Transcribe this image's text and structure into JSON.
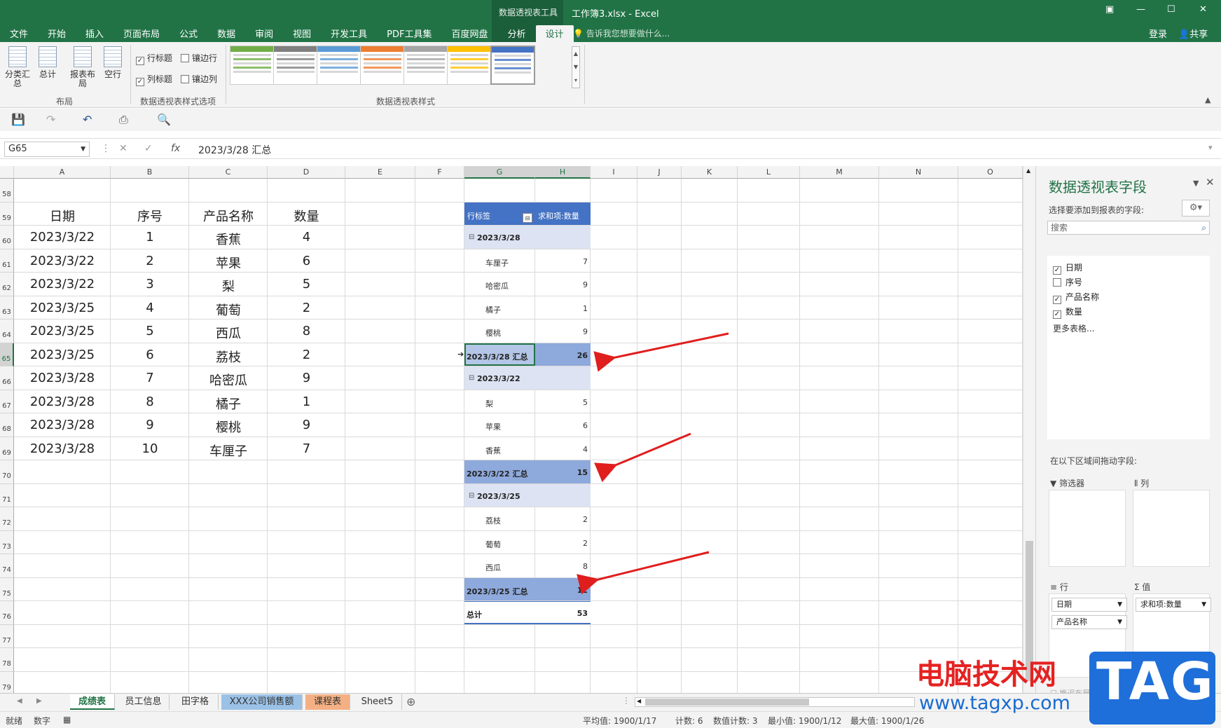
{
  "window": {
    "context_tab": "数据透视表工具",
    "doc_title": "工作簿3.xlsx - Excel",
    "tell_me": "告诉我您想要做什么...",
    "login": "登录",
    "share": "共享"
  },
  "menu_tabs": [
    "文件",
    "开始",
    "插入",
    "页面布局",
    "公式",
    "数据",
    "审阅",
    "视图",
    "开发工具",
    "PDF工具集",
    "百度网盘",
    "分析",
    "设计"
  ],
  "active_tab": "设计",
  "ribbon": {
    "subtotals": "分类汇总",
    "grandtotals": "总计",
    "report_layout": "报表布局",
    "blank_rows": "空行",
    "layout_group": "布局",
    "row_headers": "行标题",
    "col_headers": "列标题",
    "banded_rows": "镶边行",
    "banded_cols": "镶边列",
    "options_group": "数据透视表样式选项",
    "styles_group": "数据透视表样式",
    "style_colors": [
      "#70ad47",
      "#7f7f7f",
      "#5b9bd5",
      "#ed7d31",
      "#a5a5a5",
      "#ffc000",
      "#4472c4"
    ]
  },
  "formula_bar": {
    "name_box": "G65",
    "formula": "2023/3/28 汇总"
  },
  "columns": [
    "A",
    "B",
    "C",
    "D",
    "E",
    "F",
    "G",
    "H",
    "I",
    "J",
    "K",
    "L",
    "M",
    "N",
    "O"
  ],
  "rows": [
    "58",
    "59",
    "60",
    "61",
    "62",
    "63",
    "64",
    "65",
    "66",
    "67",
    "68",
    "69",
    "70",
    "71",
    "72",
    "73",
    "74",
    "75",
    "76",
    "77",
    "78",
    "79"
  ],
  "table": {
    "headers": [
      "日期",
      "序号",
      "产品名称",
      "数量"
    ],
    "rows": [
      [
        "2023/3/22",
        "1",
        "香蕉",
        "4"
      ],
      [
        "2023/3/22",
        "2",
        "苹果",
        "6"
      ],
      [
        "2023/3/22",
        "3",
        "梨",
        "5"
      ],
      [
        "2023/3/25",
        "4",
        "葡萄",
        "2"
      ],
      [
        "2023/3/25",
        "5",
        "西瓜",
        "8"
      ],
      [
        "2023/3/25",
        "6",
        "荔枝",
        "2"
      ],
      [
        "2023/3/28",
        "7",
        "哈密瓜",
        "9"
      ],
      [
        "2023/3/28",
        "8",
        "橘子",
        "1"
      ],
      [
        "2023/3/28",
        "9",
        "樱桃",
        "9"
      ],
      [
        "2023/3/28",
        "10",
        "车厘子",
        "7"
      ]
    ]
  },
  "pivot": {
    "header_label": "行标签",
    "header_value": "求和项:数量",
    "groups": [
      {
        "date": "2023/3/28",
        "items": [
          [
            "车厘子",
            "7"
          ],
          [
            "哈密瓜",
            "9"
          ],
          [
            "橘子",
            "1"
          ],
          [
            "樱桃",
            "9"
          ]
        ],
        "total_label": "2023/3/28 汇总",
        "total": "26"
      },
      {
        "date": "2023/3/22",
        "items": [
          [
            "梨",
            "5"
          ],
          [
            "苹果",
            "6"
          ],
          [
            "香蕉",
            "4"
          ]
        ],
        "total_label": "2023/3/22 汇总",
        "total": "15"
      },
      {
        "date": "2023/3/25",
        "items": [
          [
            "荔枝",
            "2"
          ],
          [
            "葡萄",
            "2"
          ],
          [
            "西瓜",
            "8"
          ]
        ],
        "total_label": "2023/3/25 汇总",
        "total": "12"
      }
    ],
    "grand_label": "总计",
    "grand_total": "53",
    "collapse_glyph": "⊟"
  },
  "sheets": [
    "成绩表",
    "员工信息",
    "田字格",
    "XXX公司销售额",
    "课程表",
    "Sheet5"
  ],
  "active_sheet": "成绩表",
  "status": {
    "ready": "就绪",
    "mode": "数字",
    "average": "平均值: 1900/1/17",
    "count": "计数: 6",
    "numeric_count": "数值计数: 3",
    "min": "最小值: 1900/1/12",
    "max": "最大值: 1900/1/26"
  },
  "field_pane": {
    "title": "数据透视表字段",
    "subtitle": "选择要添加到报表的字段:",
    "search_placeholder": "搜索",
    "fields": [
      {
        "name": "日期",
        "checked": true
      },
      {
        "name": "序号",
        "checked": false
      },
      {
        "name": "产品名称",
        "checked": true
      },
      {
        "name": "数量",
        "checked": true
      }
    ],
    "more_tables": "更多表格...",
    "drag_hint": "在以下区域间拖动字段:",
    "filters": "筛选器",
    "columns": "列",
    "rows": "行",
    "values": "值",
    "row_fields": [
      "日期",
      "产品名称"
    ],
    "value_fields": [
      "求和项:数量"
    ],
    "defer": "推迟布局更新"
  },
  "watermark": {
    "cn": "电脑技术网",
    "url": "www.tagxp.com",
    "tag": "TAG"
  }
}
